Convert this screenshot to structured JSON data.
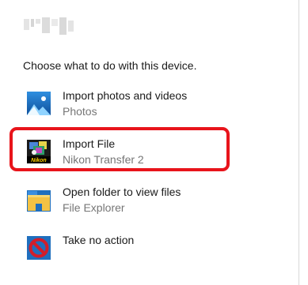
{
  "dialog": {
    "prompt": "Choose what to do with this device."
  },
  "options": [
    {
      "title": "Import photos and videos",
      "subtitle": "Photos",
      "icon": "photos-icon"
    },
    {
      "title": "Import File",
      "subtitle": "Nikon Transfer 2",
      "icon": "nikon-transfer-icon",
      "icon_text": "Nikon"
    },
    {
      "title": "Open folder to view files",
      "subtitle": "File Explorer",
      "icon": "folder-icon"
    },
    {
      "title": "Take no action",
      "subtitle": "",
      "icon": "no-action-icon"
    }
  ],
  "colors": {
    "highlight": "#e8141b",
    "photos_tile": "#1463b8",
    "folder": "#f3c244",
    "no_action": "#d11e2b"
  }
}
